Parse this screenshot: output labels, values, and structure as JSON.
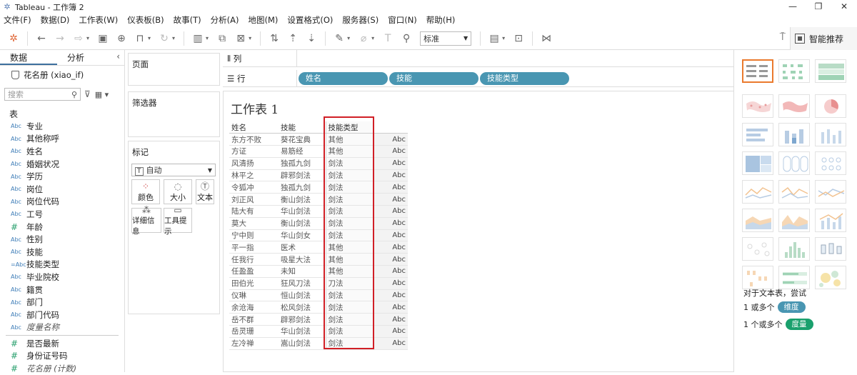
{
  "window": {
    "title": "Tableau - 工作簿 2",
    "controls": [
      "—",
      "❐",
      "✕"
    ]
  },
  "menu": [
    "文件(F)",
    "数据(D)",
    "工作表(W)",
    "仪表板(B)",
    "故事(T)",
    "分析(A)",
    "地图(M)",
    "设置格式(O)",
    "服务器(S)",
    "窗口(N)",
    "帮助(H)"
  ],
  "toolbar": {
    "fit_value": "标准",
    "smart_label": "智能推荐"
  },
  "data_pane": {
    "tabs": [
      "数据",
      "分析"
    ],
    "datasource": "花名册 (xiao_if)",
    "search_placeholder": "搜索",
    "section_tables": "表",
    "dimensions": [
      {
        "type": "Abc",
        "name": "专业"
      },
      {
        "type": "Abc",
        "name": "其他称呼"
      },
      {
        "type": "Abc",
        "name": "姓名"
      },
      {
        "type": "Abc",
        "name": "婚姻状况"
      },
      {
        "type": "Abc",
        "name": "学历"
      },
      {
        "type": "Abc",
        "name": "岗位"
      },
      {
        "type": "Abc",
        "name": "岗位代码"
      },
      {
        "type": "Abc",
        "name": "工号"
      },
      {
        "type": "#",
        "name": "年龄"
      },
      {
        "type": "Abc",
        "name": "性别"
      },
      {
        "type": "Abc",
        "name": "技能"
      },
      {
        "type": "=Abc",
        "name": "技能类型"
      },
      {
        "type": "Abc",
        "name": "毕业院校"
      },
      {
        "type": "Abc",
        "name": "籍贯"
      },
      {
        "type": "Abc",
        "name": "部门"
      },
      {
        "type": "Abc",
        "name": "部门代码"
      },
      {
        "type": "Abc",
        "name": "度量名称",
        "italic": true
      }
    ],
    "measures": [
      {
        "type": "#",
        "name": "是否最新"
      },
      {
        "type": "#",
        "name": "身份证号码"
      },
      {
        "type": "#",
        "name": "花名册 (计数)",
        "italic": true
      }
    ]
  },
  "cards": {
    "pages": "页面",
    "filters": "筛选器",
    "marks": "标记",
    "mark_type": "自动",
    "mark_buttons": [
      "颜色",
      "大小",
      "文本",
      "详细信息",
      "工具提示"
    ]
  },
  "shelves": {
    "columns_label": "列",
    "rows_label": "行",
    "rows_pills": [
      "姓名",
      "技能",
      "技能类型"
    ]
  },
  "sheet": {
    "title": "工作表 1",
    "headers": [
      "姓名",
      "技能",
      "技能类型"
    ],
    "rows": [
      [
        "东方不败",
        "葵花宝典",
        "其他",
        "Abc"
      ],
      [
        "方证",
        "易筋经",
        "其他",
        "Abc"
      ],
      [
        "风清扬",
        "独孤九剑",
        "剑法",
        "Abc"
      ],
      [
        "林平之",
        "辟邪剑法",
        "剑法",
        "Abc"
      ],
      [
        "令狐冲",
        "独孤九剑",
        "剑法",
        "Abc"
      ],
      [
        "刘正风",
        "衡山剑法",
        "剑法",
        "Abc"
      ],
      [
        "陆大有",
        "华山剑法",
        "剑法",
        "Abc"
      ],
      [
        "莫大",
        "衡山剑法",
        "剑法",
        "Abc"
      ],
      [
        "宁中则",
        "华山剑女",
        "剑法",
        "Abc"
      ],
      [
        "平一指",
        "医术",
        "其他",
        "Abc"
      ],
      [
        "任我行",
        "吸星大法",
        "其他",
        "Abc"
      ],
      [
        "任盈盈",
        "未知",
        "其他",
        "Abc"
      ],
      [
        "田伯光",
        "狂风刀法",
        "刀法",
        "Abc"
      ],
      [
        "仪琳",
        "恒山剑法",
        "剑法",
        "Abc"
      ],
      [
        "余沧海",
        "松风剑法",
        "剑法",
        "Abc"
      ],
      [
        "岳不群",
        "辟邪剑法",
        "剑法",
        "Abc"
      ],
      [
        "岳灵珊",
        "华山剑法",
        "剑法",
        "Abc"
      ],
      [
        "左冷禅",
        "嵩山剑法",
        "剑法",
        "Abc"
      ]
    ]
  },
  "show_me": {
    "tip": "对于文本表，尝试",
    "req1_prefix": "1 或多个",
    "req1_badge": "维度",
    "req2_prefix": "1 个或多个",
    "req2_badge": "度量",
    "colors": {
      "dimension": "#4996b2",
      "measure": "#1aa06d",
      "selected": "#ea7a2d"
    }
  }
}
